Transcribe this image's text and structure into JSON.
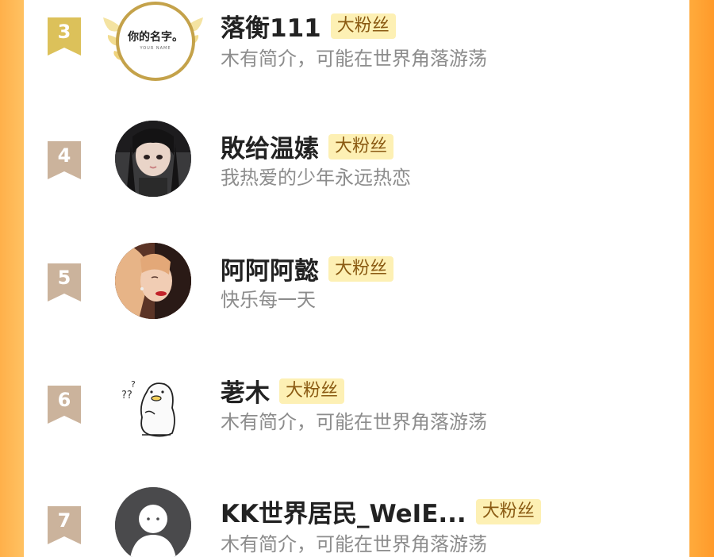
{
  "colors": {
    "accent_orange": "#ffa93a",
    "gold_rank": "#dcc15a",
    "bronze_rank": "#cbb39c",
    "badge_bg": "#fdf0b4",
    "badge_text": "#8a5a12",
    "name_text": "#222222",
    "bio_text": "#8c8c8c"
  },
  "fans": [
    {
      "rank": "3",
      "name": "落衡111",
      "badge": "大粉丝",
      "bio": "木有简介，可能在世界角落游荡",
      "avatar_icon": "name-card-avatar-icon",
      "avatar_text": "你的名字。",
      "avatar_subtext": "YOUR NAME",
      "rank_style": "gold"
    },
    {
      "rank": "4",
      "name": "敗给温嫊",
      "badge": "大粉丝",
      "bio": "我热爱的少年永远热恋",
      "avatar_icon": "girl-photo-avatar-icon",
      "rank_style": "bronze"
    },
    {
      "rank": "5",
      "name": "阿阿阿懿",
      "badge": "大粉丝",
      "bio": "快乐每一天",
      "avatar_icon": "girl-photo-avatar-icon",
      "rank_style": "bronze"
    },
    {
      "rank": "6",
      "name": "荖木",
      "badge": "大粉丝",
      "bio": "木有简介，可能在世界角落游荡",
      "avatar_icon": "confused-duck-avatar-icon",
      "rank_style": "bronze"
    },
    {
      "rank": "7",
      "name": "KK世界居民_WeIE...",
      "badge": "大粉丝",
      "bio": "木有简介，可能在世界角落游荡",
      "avatar_icon": "default-user-avatar-icon",
      "rank_style": "bronze"
    }
  ]
}
